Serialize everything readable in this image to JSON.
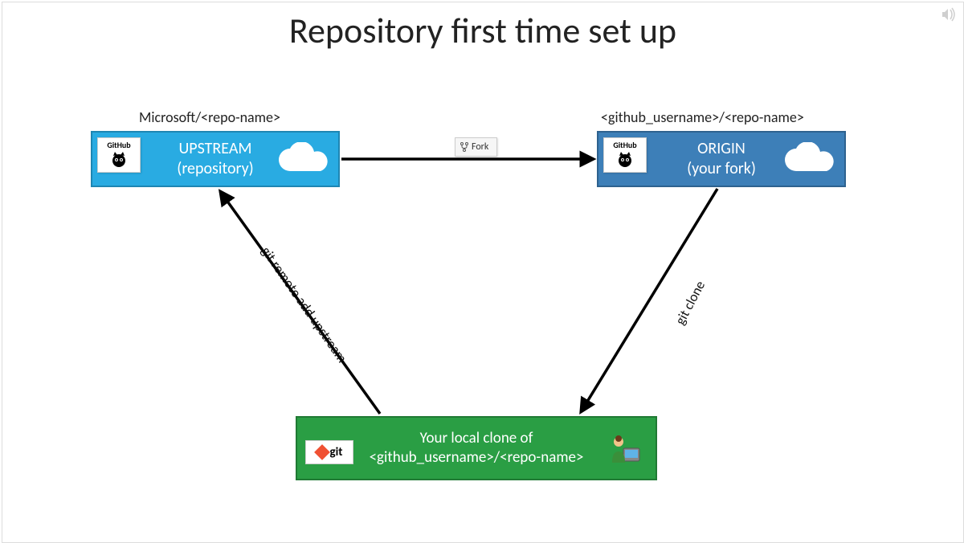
{
  "title": "Repository first time set up",
  "upstream": {
    "label": "Microsoft/<repo-name>",
    "line1": "UPSTREAM",
    "line2": "(repository)",
    "badge": "GitHub"
  },
  "origin": {
    "label": "<github_username>/<repo-name>",
    "line1": "ORIGIN",
    "line2": "(your fork)",
    "badge": "GitHub"
  },
  "local": {
    "line1": "Your local clone of",
    "line2": "<github_username>/<repo-name>",
    "badge": "git"
  },
  "fork_button": "Fork",
  "arrows": {
    "remote_add": "git remote add upstream",
    "clone": "git clone"
  },
  "colors": {
    "upstream": "#29abe2",
    "origin": "#3d7fb8",
    "local": "#2a9e44"
  }
}
